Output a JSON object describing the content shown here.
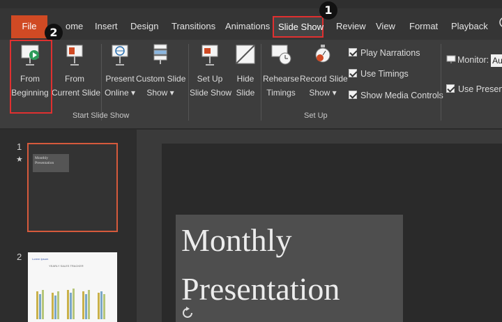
{
  "tabs": {
    "file": "File",
    "home": "ome",
    "insert": "Insert",
    "design": "Design",
    "transitions": "Transitions",
    "animations": "Animations",
    "slide_show": "Slide Show",
    "review": "Review",
    "view": "View",
    "format": "Format",
    "playback": "Playback"
  },
  "callouts": {
    "one": "1",
    "two": "2"
  },
  "ribbon": {
    "start_slide_show": {
      "group_label": "Start Slide Show",
      "from_beginning": [
        "From",
        "Beginning"
      ],
      "from_current": [
        "From",
        "Current Slide"
      ],
      "present_online": [
        "Present",
        "Online ▾"
      ],
      "custom_show": [
        "Custom Slide",
        "Show ▾"
      ]
    },
    "set_up": {
      "group_label": "Set Up",
      "set_up_show": [
        "Set Up",
        "Slide Show"
      ],
      "hide_slide": [
        "Hide",
        "Slide"
      ],
      "rehearse": [
        "Rehearse",
        "Timings"
      ],
      "record": [
        "Record Slide",
        "Show ▾"
      ],
      "play_narrations": "Play Narrations",
      "use_timings": "Use Timings",
      "show_media_controls": "Show Media Controls"
    },
    "monitors": {
      "monitor_label": "Monitor:",
      "monitor_value": "Au",
      "use_presenter": "Use Presente"
    }
  },
  "thumbnails": [
    {
      "number": "1",
      "star": "★",
      "title": "Monthly Presentation"
    },
    {
      "number": "2",
      "title": "Lorem Ipsum",
      "subtitle": "YEARLY SALES TRACKER"
    }
  ],
  "slide": {
    "title_line1": "Monthly",
    "title_line2": "Presentation"
  },
  "colors": {
    "file_tab": "#d04a24",
    "highlight": "#e03030",
    "selected_thumb_border": "#d65a3c"
  }
}
